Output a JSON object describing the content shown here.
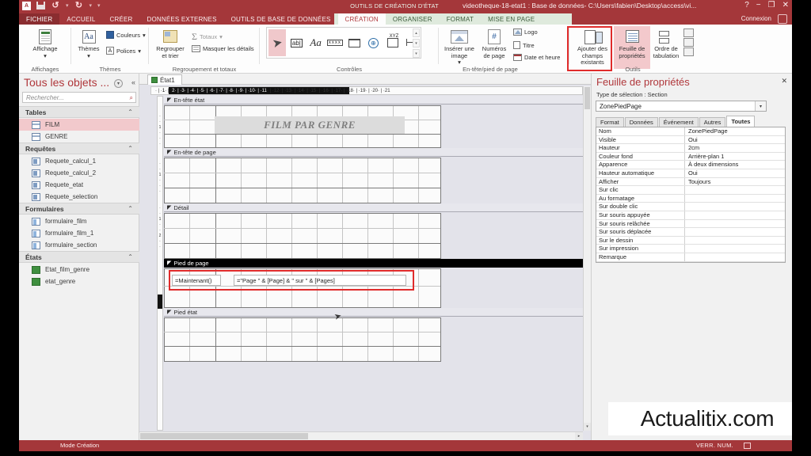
{
  "window": {
    "title": "videotheque-18-etat1 : Base de données- C:\\Users\\fabien\\Desktop\\access\\vi...",
    "contextual_title": "OUTILS DE CRÉATION D'ÉTAT",
    "help": "?",
    "minimize": "−",
    "restore": "❐",
    "close": "✕",
    "connexion": "Connexion",
    "qat": {
      "access_icon": "access-logo",
      "save_icon": "save-icon",
      "undo": "↺",
      "redo": "↻",
      "more": "▾"
    }
  },
  "tabs": [
    {
      "label": "FICHIER",
      "kind": "file"
    },
    {
      "label": "ACCUEIL",
      "kind": "normal"
    },
    {
      "label": "CRÉER",
      "kind": "normal"
    },
    {
      "label": "DONNÉES EXTERNES",
      "kind": "normal"
    },
    {
      "label": "OUTILS DE BASE DE DONNÉES",
      "kind": "normal"
    },
    {
      "label": "CRÉATION",
      "kind": "context-active"
    },
    {
      "label": "ORGANISER",
      "kind": "context"
    },
    {
      "label": "FORMAT",
      "kind": "context"
    },
    {
      "label": "MISE EN PAGE",
      "kind": "context"
    }
  ],
  "ribbon": {
    "groups": [
      {
        "name": "Affichages",
        "label": "Affichages"
      },
      {
        "name": "Themes",
        "label": "Thèmes"
      },
      {
        "name": "Regroupement",
        "label": "Regroupement et totaux"
      },
      {
        "name": "Controles",
        "label": "Contrôles"
      },
      {
        "name": "EnteteP",
        "label": "En-tête/pied de page"
      },
      {
        "name": "Outils",
        "label": "Outils"
      }
    ],
    "affichage": {
      "label": "Affichage",
      "caret": "▾",
      "icon": "view-report-icon"
    },
    "themes": {
      "themes_label": "Thèmes",
      "themes_caret": "▾",
      "themes_icon": "themes-icon",
      "couleurs_label": "Couleurs",
      "couleurs_caret": "▾",
      "couleurs_icon": "colors-icon",
      "polices_label": "Polices",
      "polices_caret": "▾",
      "polices_icon": "fonts-icon",
      "polices_glyph": "A"
    },
    "regroupement": {
      "grouper_label": "Regrouper\net trier",
      "grouper_icon": "group-sort-icon",
      "totaux_label": "Totaux",
      "totaux_caret": "▾",
      "totaux_glyph": "Σ",
      "masquer_label": "Masquer les détails",
      "masquer_icon": "hide-details-icon"
    },
    "controles": {
      "items": [
        {
          "name": "select-tool",
          "glyph": "selection-arrow-icon",
          "selected": true
        },
        {
          "name": "textbox-tool",
          "glyph": "ab|"
        },
        {
          "name": "label-tool",
          "glyph": "Aa"
        },
        {
          "name": "button-tool",
          "glyph": "xxxx"
        },
        {
          "name": "tab-tool",
          "glyph": "folder-icon"
        },
        {
          "name": "hyperlink-tool",
          "glyph": "globe-icon"
        },
        {
          "name": "navigation-tool",
          "glyph": "XYZ"
        },
        {
          "name": "line-tool",
          "glyph": "line-icon"
        }
      ],
      "scroll_up": "▴",
      "scroll_down": "▾",
      "scroll_more": "▾"
    },
    "entete_pied": {
      "image_label": "Insérer une\nimage",
      "image_caret": "▾",
      "image_icon": "insert-image-icon",
      "numeros_label": "Numéros\nde page",
      "numeros_icon": "page-number-icon",
      "numeros_glyph": "#",
      "logo_label": "Logo",
      "logo_icon": "logo-icon",
      "titre_label": "Titre",
      "titre_icon": "title-icon",
      "date_label": "Date et heure",
      "date_icon": "date-time-icon"
    },
    "outils": {
      "ajouter_label": "Ajouter des\nchamps existants",
      "ajouter_icon": "add-existing-fields-icon",
      "feuille_label": "Feuille de\npropriétés",
      "feuille_icon": "property-sheet-icon",
      "ordre_label": "Ordre de\ntabulation",
      "ordre_icon": "tab-order-icon"
    }
  },
  "navpane": {
    "title": "Tous les objets ...",
    "menu_icon": "▾",
    "collapse_icon": "«",
    "search_placeholder": "Rechercher...",
    "search_icon": "search-icon",
    "groups": [
      {
        "label": "Tables",
        "chevron": "⌃",
        "items": [
          {
            "label": "FILM",
            "icon": "table-icon",
            "selected": true
          },
          {
            "label": "GENRE",
            "icon": "table-icon",
            "selected": false
          }
        ]
      },
      {
        "label": "Requêtes",
        "chevron": "⌃",
        "items": [
          {
            "label": "Requete_calcul_1",
            "icon": "query-icon",
            "selected": false
          },
          {
            "label": "Requete_calcul_2",
            "icon": "query-icon",
            "selected": false
          },
          {
            "label": "Requete_etat",
            "icon": "query-icon",
            "selected": false
          },
          {
            "label": "Requete_selection",
            "icon": "query-icon",
            "selected": false
          }
        ]
      },
      {
        "label": "Formulaires",
        "chevron": "⌃",
        "items": [
          {
            "label": "formulaire_film",
            "icon": "form-icon",
            "selected": false
          },
          {
            "label": "formulaire_film_1",
            "icon": "form-icon",
            "selected": false
          },
          {
            "label": "formulaire_section",
            "icon": "form-icon",
            "selected": false
          }
        ]
      },
      {
        "label": "États",
        "chevron": "⌃",
        "items": [
          {
            "label": "Etat_film_genre",
            "icon": "report-icon",
            "selected": false
          },
          {
            "label": "etat_genre",
            "icon": "report-icon",
            "selected": false
          }
        ]
      }
    ]
  },
  "design": {
    "doc_tab": {
      "label": "État1",
      "icon": "report-icon"
    },
    "ruler": {
      "h_ticks": [
        "1",
        "2",
        "3",
        "4",
        "5",
        "6",
        "7",
        "8",
        "9",
        "10",
        "11",
        "12",
        "13",
        "14",
        "15",
        "16",
        "17",
        "18",
        "19",
        "20",
        "21"
      ],
      "v_ticks": [
        "1",
        "1",
        "2"
      ],
      "highlight_from": "2",
      "highlight_to": "11"
    },
    "sections": [
      {
        "name": "report-header",
        "label": "En-tête état",
        "marker": "◤"
      },
      {
        "name": "page-header",
        "label": "En-tête de page",
        "marker": "◤"
      },
      {
        "name": "detail",
        "label": "Détail",
        "marker": "◤"
      },
      {
        "name": "page-footer",
        "label": "Pied de page",
        "marker": "◤",
        "black": true
      },
      {
        "name": "report-footer",
        "label": "Pied état",
        "marker": "◤"
      }
    ],
    "controls": {
      "title_label": "FILM PAR GENRE",
      "now_textbox": "=Maintenant()",
      "page_textbox": "=\"Page \" & [Page] & \" sur \" & [Pages]"
    }
  },
  "propsheet": {
    "title": "Feuille de propriétés",
    "close_icon": "✕",
    "selection_type": "Type de sélection :  Section",
    "selected_object": "ZonePiedPage",
    "dropdown_icon": "▾",
    "tabs": [
      {
        "label": "Format",
        "active": false
      },
      {
        "label": "Données",
        "active": false
      },
      {
        "label": "Événement",
        "active": false
      },
      {
        "label": "Autres",
        "active": false
      },
      {
        "label": "Toutes",
        "active": true
      }
    ],
    "rows": [
      {
        "key": "Nom",
        "value": "ZonePiedPage"
      },
      {
        "key": "Visible",
        "value": "Oui"
      },
      {
        "key": "Hauteur",
        "value": "2cm"
      },
      {
        "key": "Couleur fond",
        "value": "Arrière-plan 1"
      },
      {
        "key": "Apparence",
        "value": "À deux dimensions"
      },
      {
        "key": "Hauteur automatique",
        "value": "Oui"
      },
      {
        "key": "Afficher",
        "value": "Toujours"
      },
      {
        "key": "Sur clic",
        "value": ""
      },
      {
        "key": "Au formatage",
        "value": ""
      },
      {
        "key": "Sur double clic",
        "value": ""
      },
      {
        "key": "Sur souris appuyée",
        "value": ""
      },
      {
        "key": "Sur souris relâchée",
        "value": ""
      },
      {
        "key": "Sur souris déplacée",
        "value": ""
      },
      {
        "key": "Sur le dessin",
        "value": ""
      },
      {
        "key": "Sur impression",
        "value": ""
      },
      {
        "key": "Remarque",
        "value": ""
      }
    ]
  },
  "watermark": "Actualitix.com",
  "statusbar": {
    "mode": "Mode Création",
    "numlock": "VERR. NUM.",
    "view_icon": "design-view-icon"
  },
  "colors": {
    "accent": "#a4373a",
    "accent_dark": "#8a2d30",
    "context": "#dfeadd",
    "highlight": "#e02b2b",
    "pink": "#f3c9cc"
  }
}
